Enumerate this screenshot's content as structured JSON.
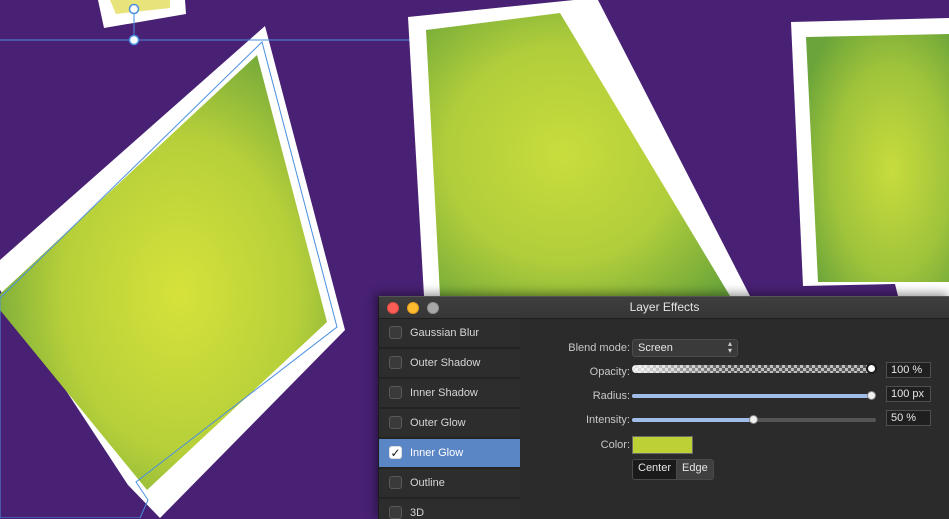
{
  "canvas": {
    "background_color": "#482174",
    "photo_colors": {
      "light": "#d1e03c",
      "dark": "#6aa43a"
    },
    "frame_color": "#ffffff",
    "selection_color": "#4a8fe0"
  },
  "panel": {
    "title": "Layer Effects",
    "window_controls": [
      "close-icon",
      "minimize-icon",
      "zoom-icon"
    ],
    "effects": [
      {
        "label": "Gaussian Blur",
        "checked": false
      },
      {
        "label": "Outer Shadow",
        "checked": false
      },
      {
        "label": "Inner Shadow",
        "checked": false
      },
      {
        "label": "Outer Glow",
        "checked": false
      },
      {
        "label": "Inner Glow",
        "checked": true
      },
      {
        "label": "Outline",
        "checked": false
      },
      {
        "label": "3D",
        "checked": false
      }
    ],
    "selected_effect": "Inner Glow",
    "settings": {
      "blend_mode_label": "Blend mode:",
      "blend_mode_value": "Screen",
      "opacity_label": "Opacity:",
      "opacity_value": "100 %",
      "opacity_fraction": 1.0,
      "radius_label": "Radius:",
      "radius_value": "100 px",
      "radius_fraction": 1.0,
      "intensity_label": "Intensity:",
      "intensity_value": "50 %",
      "intensity_fraction": 0.5,
      "color_label": "Color:",
      "color_value": "#bdd136",
      "center_label": "Center",
      "edge_label": "Edge",
      "selected_mode": "Center"
    },
    "accent_color": "#5b86c5"
  }
}
